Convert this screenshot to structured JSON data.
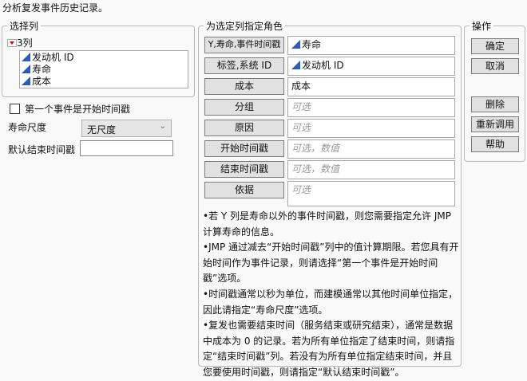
{
  "title": "分析复发事件历史记录。",
  "select_columns": {
    "legend": "选择列",
    "count_label": "3列",
    "columns": [
      "发动机 ID",
      "寿命",
      "成本"
    ]
  },
  "options": {
    "first_event_start": "第一个事件是开始时间戳",
    "first_event_start_checked": false,
    "life_scale_label": "寿命尺度",
    "life_scale_value": "无尺度",
    "default_end_label": "默认结束时间戳",
    "default_end_value": ""
  },
  "roles": {
    "legend": "为选定列指定角色",
    "items": [
      {
        "button": "Y,寿命,事件时间戳",
        "value": "寿命",
        "icon": true,
        "placeholder": false
      },
      {
        "button": "标签,系统 ID",
        "value": "发动机 ID",
        "icon": true,
        "placeholder": false
      },
      {
        "button": "成本",
        "value": "成本",
        "icon": false,
        "placeholder": false
      },
      {
        "button": "分组",
        "value": "可选",
        "icon": false,
        "placeholder": true
      },
      {
        "button": "原因",
        "value": "可选",
        "icon": false,
        "placeholder": true
      },
      {
        "button": "开始时间戳",
        "value": "可选，数值",
        "icon": false,
        "placeholder": true
      },
      {
        "button": "结束时间戳",
        "value": "可选，数值",
        "icon": false,
        "placeholder": true
      },
      {
        "button": "依据",
        "value": "可选",
        "icon": false,
        "placeholder": true
      }
    ]
  },
  "help_text": [
    "•若 Y 列是寿命以外的事件时间戳，则您需要指定允许 JMP 计算寿命的信息。",
    "•JMP 通过减去“开始时间戳”列中的值计算期限。若您具有开始时间作为事件记录，则请选择“第一个事件是开始时间戳”选项。",
    "•时间戳通常以秒为单位，而建模通常以其他时间单位指定，因此请指定“寿命尺度”选项。",
    "•复发也需要结束时间（服务结束或研究结束），通常是数据中成本为 0 的记录。若为所有单位指定了结束时间，则请指定“结束时间戳”列。若没有为所有单位指定结束时间，并且您要使用时间戳，则请指定“默认结束时间戳”。"
  ],
  "actions": {
    "legend": "操作",
    "ok": "确定",
    "cancel": "取消",
    "remove": "删除",
    "recall": "重新调用",
    "help": "帮助"
  }
}
